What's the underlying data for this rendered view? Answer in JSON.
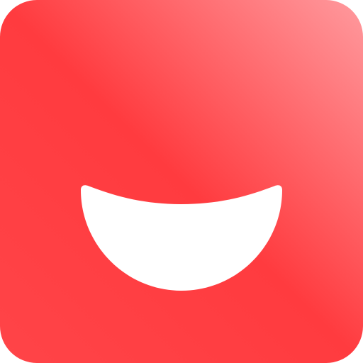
{
  "icon": {
    "name": "smile-app-icon",
    "shape": "rounded-square",
    "colors": {
      "gradient_top_right": "#ff9a9e",
      "gradient_mid": "#ff3b3f",
      "gradient_bottom": "#ff4448",
      "mouth": "#ffffff"
    }
  }
}
